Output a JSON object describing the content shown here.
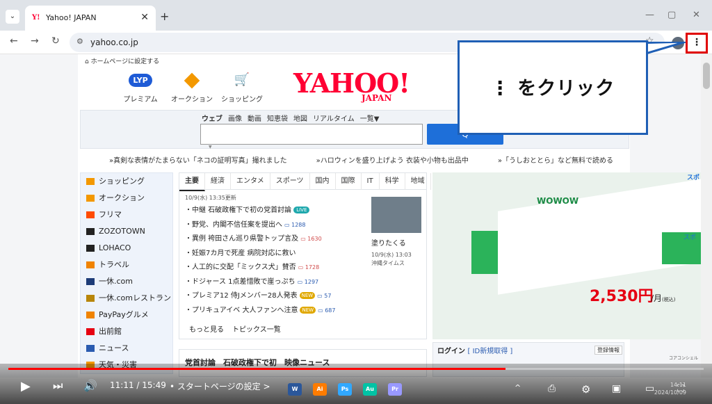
{
  "browser": {
    "tab_title": "Yahoo! JAPAN",
    "tab_favicon": "Y!",
    "new_tab": "+",
    "close_tab": "✕",
    "url": "yahoo.co.jp",
    "window_controls": [
      "—",
      "▢",
      "✕"
    ],
    "menu_glyph": "⋮"
  },
  "yahoo": {
    "set_homepage": "ホームページに設定する",
    "services": [
      {
        "icon": "lyp-premium-icon",
        "label": "プレミアム",
        "badge": "LYP"
      },
      {
        "icon": "auction-icon",
        "label": "オークション"
      },
      {
        "icon": "shopping-cart-icon",
        "label": "ショッピング"
      }
    ],
    "logo_main": "YAHOO!",
    "logo_sub": "JAPAN",
    "search_tabs": [
      "ウェブ",
      "画像",
      "動画",
      "知恵袋",
      "地図",
      "リアルタイム",
      "一覧▼"
    ],
    "search_placeholder": "",
    "search_button": "Q",
    "pickup": [
      "»真剣な表情がたまらない「ネコの証明写真」撮れました",
      "»ハロウィンを盛り上げよう 衣装や小物も出品中",
      "»「うしおととら」など無料で読める"
    ],
    "left_nav": [
      {
        "label": "ショッピング",
        "color": "#f39800"
      },
      {
        "label": "オークション",
        "color": "#f39800"
      },
      {
        "label": "フリマ",
        "color": "#ff4b00"
      },
      {
        "label": "ZOZOTOWN",
        "color": "#222222"
      },
      {
        "label": "LOHACO",
        "color": "#222222"
      },
      {
        "label": "トラベル",
        "color": "#f08300"
      },
      {
        "label": "一休.com",
        "color": "#1d3c78"
      },
      {
        "label": "一休.comレストラン",
        "color": "#b8860b"
      },
      {
        "label": "PayPayグルメ",
        "color": "#f08300"
      },
      {
        "label": "出前館",
        "color": "#e60012"
      },
      {
        "label": "ニュース",
        "color": "#2a5bb0"
      },
      {
        "label": "天気・災害",
        "color": "#f39800"
      }
    ],
    "news": {
      "tabs": [
        "主要",
        "経済",
        "エンタメ",
        "スポーツ",
        "国内",
        "国際",
        "IT",
        "科学",
        "地域"
      ],
      "updated": "10/9(水) 13:35更新",
      "items": [
        {
          "text": "・中継 石破政権下で初の党首討論",
          "badge": "LIVE",
          "comments": ""
        },
        {
          "text": "・野党、内閣不信任案を提出へ",
          "badge": "",
          "comments": "1288"
        },
        {
          "text": "・異例 袴田さん巡り県警トップ言及",
          "badge": "",
          "comments": "1630"
        },
        {
          "text": "・妊娠7カ月で死産 病院対応に救い",
          "badge": "",
          "comments": ""
        },
        {
          "text": "・人工的に交配「ミックス犬」賛否",
          "badge": "",
          "comments": "1728"
        },
        {
          "text": "・ドジャース 1点差惜敗で崖っぷち",
          "badge": "",
          "comments": "1297"
        },
        {
          "text": "・プレミア12 侍Jメンバー28人発表",
          "badge": "NEW",
          "comments": "57"
        },
        {
          "text": "・プリキュアイベ 大人ファンへ注意",
          "badge": "NEW",
          "comments": "687"
        }
      ],
      "more": "もっと見る",
      "topics": "トピックス一覧",
      "photo_caption": "塗りたくる",
      "photo_time": "10/9(水) 13:03",
      "photo_source": "沖縄タイムス"
    },
    "ad": {
      "brand": "WOWOW",
      "price": "2,530円",
      "unit": "/月",
      "unit_note": "(税込)",
      "corner": "スポ"
    },
    "video_news_title": "党首討論　石破政権下で初　映像ニュース",
    "login": {
      "title": "ログイン",
      "link": "[ ID新規取得 ]",
      "info": "登録情報"
    },
    "concierge": "コアコンシェル"
  },
  "callout": {
    "text": "⋮ をクリック"
  },
  "player": {
    "progress": 0.715,
    "time": "11:11 / 15:49",
    "chapter": "• スタートページの設定 >"
  },
  "taskbar": {
    "apps": [
      {
        "icon": "word-icon",
        "label": "W",
        "color": "#2b579a"
      },
      {
        "icon": "illustrator-icon",
        "label": "Ai",
        "color": "#ff7c00"
      },
      {
        "icon": "photoshop-icon",
        "label": "Ps",
        "color": "#31a8ff"
      },
      {
        "icon": "audition-icon",
        "label": "Au",
        "color": "#00c3a5"
      },
      {
        "icon": "premiere-icon",
        "label": "Pr",
        "color": "#9999ff"
      }
    ],
    "clock_time": "14:11",
    "clock_date": "2024/10/09"
  }
}
